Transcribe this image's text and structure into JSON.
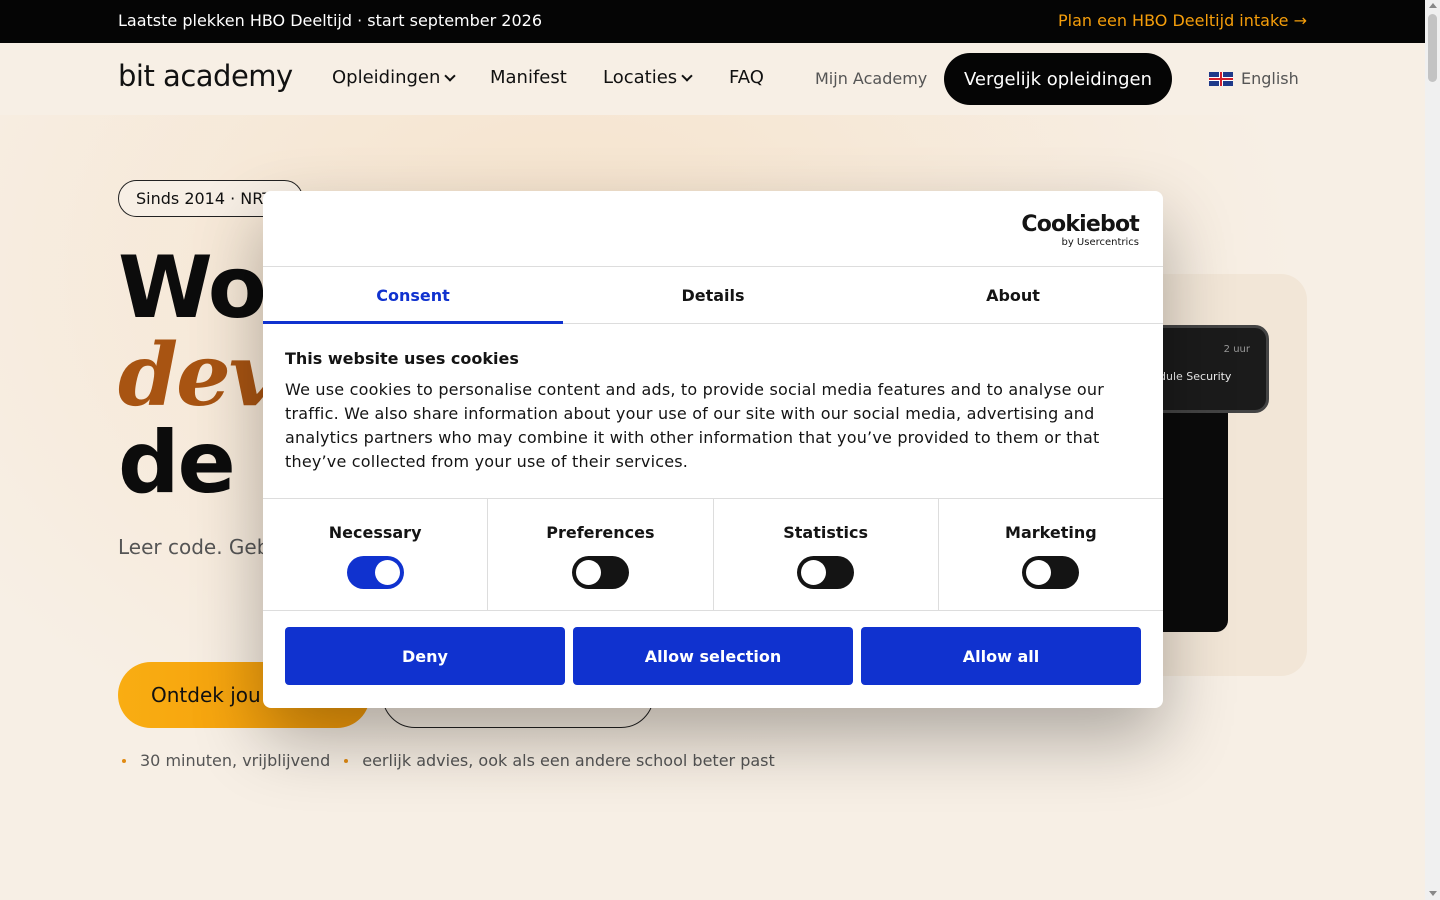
{
  "announcement": {
    "left_text": "Laatste plekken HBO Deeltijd · start september 2026",
    "right_text": "Plan een HBO Deeltijd intake →"
  },
  "nav": {
    "logo": "bit academy",
    "items": [
      {
        "label": "Opleidingen",
        "dropdown": true
      },
      {
        "label": "Manifest",
        "dropdown": false
      },
      {
        "label": "Locaties",
        "dropdown": true
      },
      {
        "label": "FAQ",
        "dropdown": false
      }
    ],
    "account_link": "Mijn Academy",
    "cta": "Vergelijk opleidingen",
    "language": "English"
  },
  "hero": {
    "pill": "Sinds 2014 · NRTO",
    "headline_line1": "Wo",
    "headline_line2": "dev",
    "headline_line3": "de t",
    "subtitle": "Leer code. Geb colleges. Geen opdrachten, co",
    "primary_button": "Ontdek jou",
    "bullets": [
      "30 minuten, vrijblijvend",
      "eerlijk advies, ook als een andere school beter past"
    ],
    "notification_time": "2 uur",
    "notification_text": "dule Security"
  },
  "cookie_dialog": {
    "brand": "Cookiebot",
    "brand_sub": "by Usercentrics",
    "tabs": [
      "Consent",
      "Details",
      "About"
    ],
    "active_tab": "Consent",
    "title": "This website uses cookies",
    "body": "We use cookies to personalise content and ads, to provide social media features and to analyse our traffic. We also share information about your use of our site with our social media, advertising and analytics partners who may combine it with other information that you’ve provided to them or that they’ve collected from your use of their services.",
    "categories": [
      {
        "label": "Necessary",
        "checked": true
      },
      {
        "label": "Preferences",
        "checked": false
      },
      {
        "label": "Statistics",
        "checked": false
      },
      {
        "label": "Marketing",
        "checked": false
      }
    ],
    "buttons": {
      "deny": "Deny",
      "allow_selection": "Allow selection",
      "allow_all": "Allow all"
    },
    "accent_color": "#1032cf"
  }
}
